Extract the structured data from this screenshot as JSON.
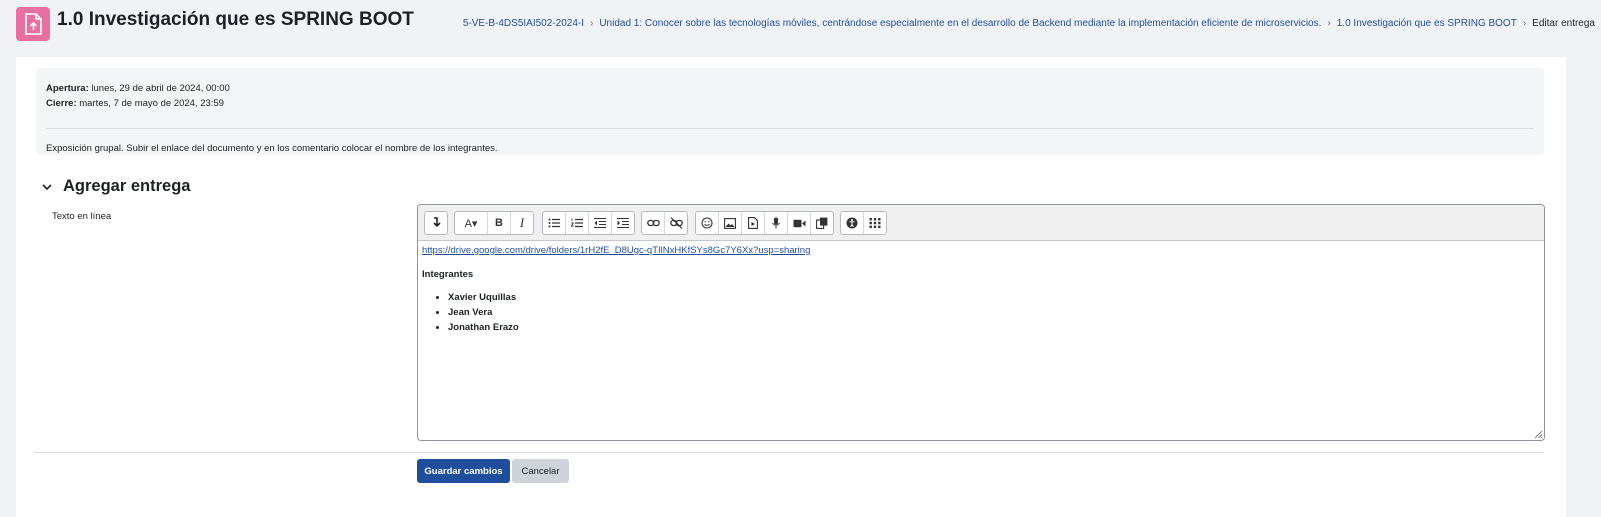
{
  "header": {
    "title": "1.0 Investigación que es SPRING BOOT",
    "icon": "assignment-upload-icon",
    "icon_color": "#e76fa1"
  },
  "breadcrumb": [
    "5-VE-B-4DS5IAI502-2024-I",
    "Unidad 1: Conocer sobre las tecnologías móviles, centrándose especialmente en el desarrollo de Backend mediante la implementación eficiente de microservicios.",
    "1.0 Investigación que es SPRING BOOT",
    "Editar entrega"
  ],
  "dates": {
    "open_label": "Apertura:",
    "open_value": "lunes, 29 de abril de 2024, 00:00",
    "close_label": "Cierre:",
    "close_value": "martes, 7 de mayo de 2024, 23:59"
  },
  "intro": "Exposición grupal. Subir el enlace del documento y en los comentario colocar el nombre de los integrantes.",
  "section": {
    "title": "Agregar entrega"
  },
  "field": {
    "label": "Texto en línea"
  },
  "toolbar": {
    "buttons": [
      "show-more-icon",
      "font-color-icon",
      "bold-icon",
      "italic-icon",
      "unordered-list-icon",
      "ordered-list-icon",
      "outdent-icon",
      "indent-icon",
      "link-icon",
      "unlink-icon",
      "emoji-icon",
      "image-icon",
      "media-icon",
      "record-audio-icon",
      "record-video-icon",
      "manage-files-icon",
      "accessibility-checker-icon",
      "screenreader-helper-icon"
    ]
  },
  "editor": {
    "link": "https://drive.google.com/drive/folders/1rH2fE_D8Ugc-qTIlNxHKfSYs8Gc7Y6Xx?usp=sharing",
    "heading": "Integrantes",
    "members": [
      "Xavier Uquillas",
      "Jean Vera",
      "Jonathan Erazo"
    ]
  },
  "buttons": {
    "save": "Guardar cambios",
    "cancel": "Cancelar"
  },
  "colors": {
    "primary": "#1f4f9c",
    "page_bg": "#f1f2f5"
  }
}
